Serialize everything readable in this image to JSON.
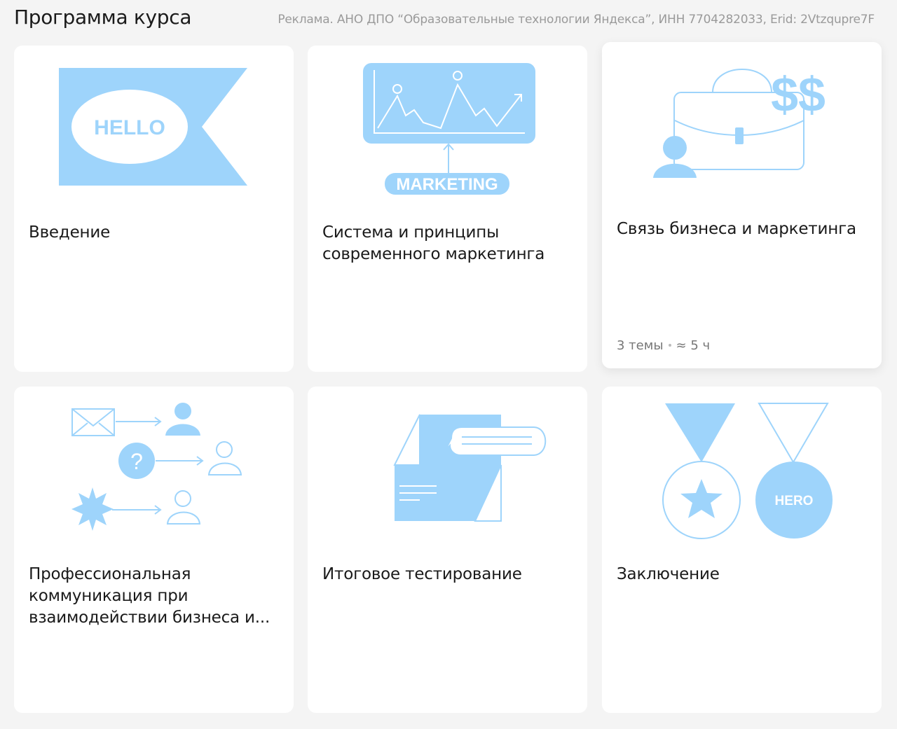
{
  "header": {
    "title": "Программа курса",
    "ad_notice": "Реклама. АНО ДПО “Образовательные технологии Яндекса”, ИНН 7704282033, Erid: 2Vtzqupre7F"
  },
  "colors": {
    "background": "#f4f4f4",
    "card": "#ffffff",
    "illustration_blue": "#9ed4fb",
    "muted_text": "#777777"
  },
  "cards": [
    {
      "title": "Введение",
      "illustration_text": "HELLO",
      "icon": "hello-flag-icon"
    },
    {
      "title": "Система и принципы современного маркетинга",
      "illustration_text": "MARKETING",
      "icon": "marketing-chart-icon"
    },
    {
      "title": "Связь бизнеса и маркетинга",
      "illustration_text": "$$",
      "icon": "briefcase-money-icon",
      "meta": {
        "topics": "3 темы",
        "duration": "≈ 5 ч"
      }
    },
    {
      "title": "Профессиональная коммуникация при взаимодействии бизнеса и...",
      "illustration_text": "?",
      "icon": "communication-icon"
    },
    {
      "title": "Итоговое тестирование",
      "icon": "document-test-icon"
    },
    {
      "title": "Заключение",
      "illustration_text": "HERO",
      "icon": "medals-icon"
    }
  ]
}
